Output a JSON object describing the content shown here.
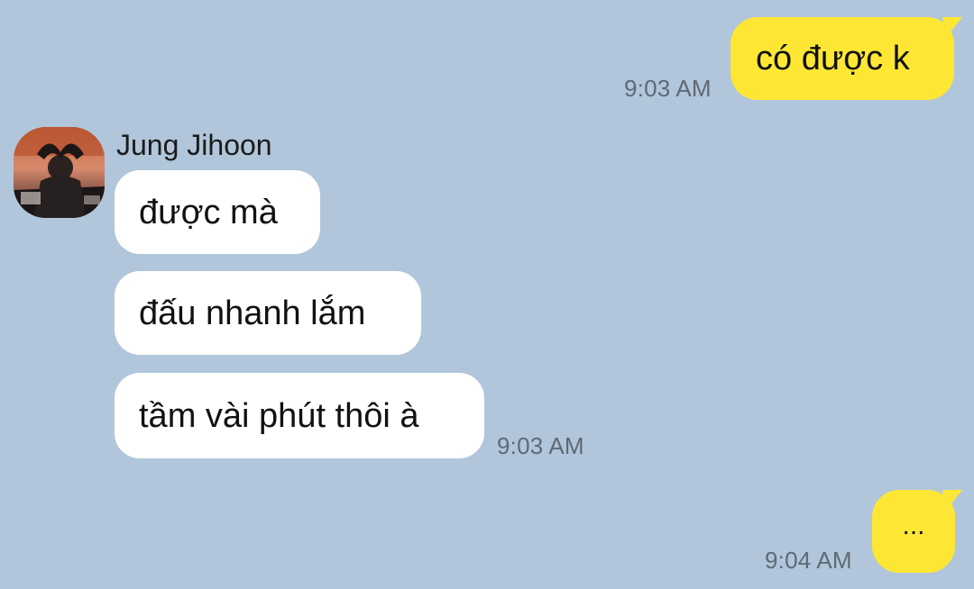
{
  "chat": {
    "messages": [
      {
        "direction": "outgoing",
        "text": "có được k",
        "time": "9:03 AM"
      },
      {
        "direction": "incoming",
        "sender": "Jung Jihoon",
        "text": "được mà"
      },
      {
        "direction": "incoming",
        "text": "đấu nhanh lắm"
      },
      {
        "direction": "incoming",
        "text": "tầm vài phút thôi à",
        "time": "9:03 AM"
      },
      {
        "direction": "outgoing",
        "text": "...",
        "time": "9:04 AM"
      }
    ]
  },
  "colors": {
    "background": "#b1c6da",
    "outgoing_bubble": "#fee734",
    "incoming_bubble": "#ffffff",
    "timestamp": "#5f6a74"
  },
  "icons": {
    "avatar": "profile-photo"
  }
}
